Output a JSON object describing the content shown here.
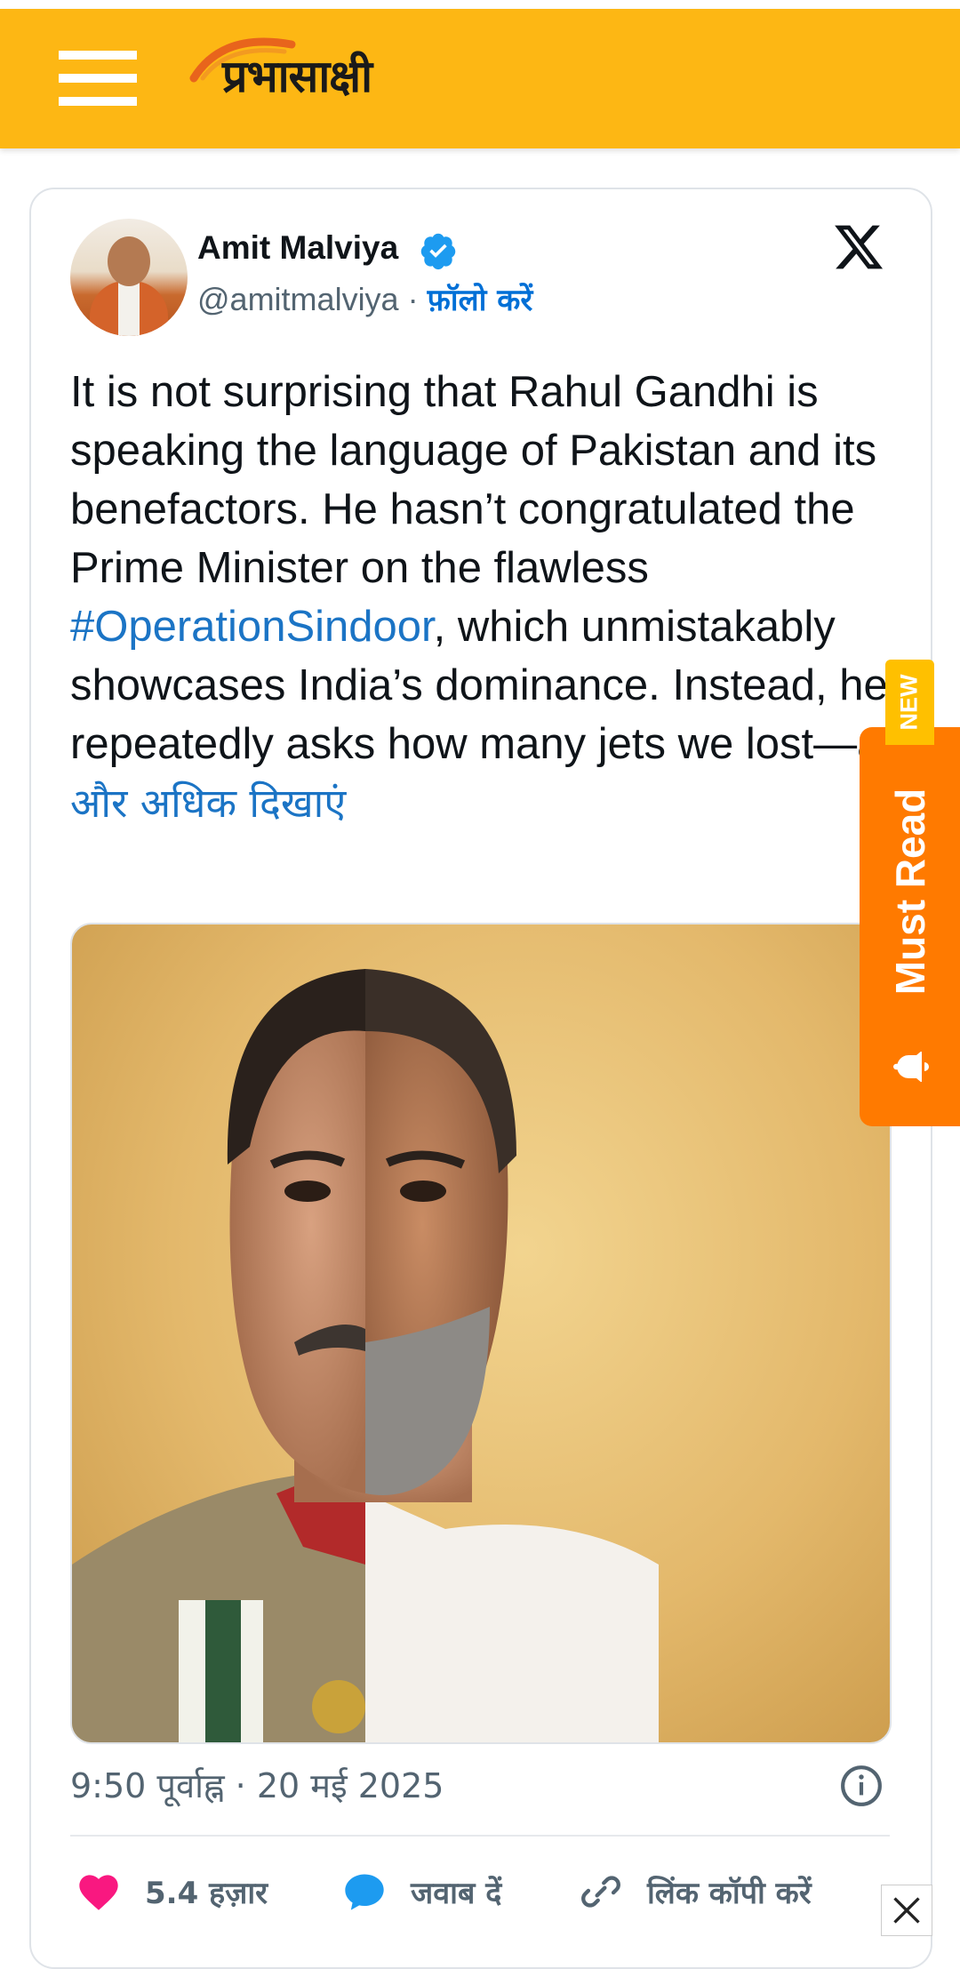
{
  "site": {
    "logo_text": "प्रभासाक्षी",
    "brand_color": "#fdb714"
  },
  "tweet": {
    "author_name": "Amit Malviya",
    "handle": "@amitmalviya",
    "separator": " · ",
    "follow_label": "फ़ॉलो करें",
    "verified": true,
    "text_before_hashtag": "It is not surprising that Rahul Gandhi is speaking the language of Pakistan and its benefactors. He hasn’t congratulated the Prime Minister on the flawless ",
    "hashtag": "#OperationSindoor",
    "text_after_hashtag": ", which unmistakably showcases India’s dominance. Instead, he repeatedly asks how many jets we lost—a ",
    "show_more_label": "और अधिक दिखाएं",
    "timestamp": "9:50 पूर्वाह्न · 20 मई 2025",
    "likes_label": "5.4 हज़ार",
    "reply_label": "जवाब दें",
    "copy_link_label": "लिंक कॉपी करें",
    "link_color": "#1b74c5"
  },
  "must_read": {
    "label": "Must Read",
    "badge": "NEW",
    "color": "#ff7a00"
  }
}
